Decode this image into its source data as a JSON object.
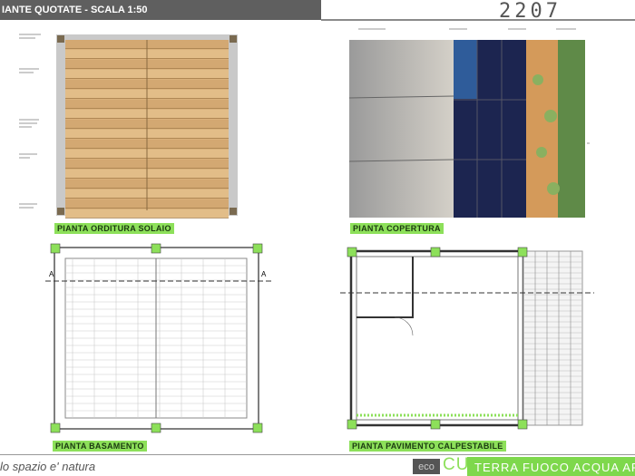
{
  "header": {
    "title": "IANTE QUOTATE - SCALA 1:50",
    "sheet_number": "2207"
  },
  "panels": {
    "p1": "PIANTA ORDITURA SOLAIO",
    "p2": "PIANTA COPERTURA",
    "p3": "PIANTA BASAMENTO",
    "p4": "PIANTA PAVIMENTO CALPESTABILE",
    "section_mark": "A"
  },
  "footer": {
    "tagline": "lo spazio e' natura",
    "logo_eco": "eco",
    "logo_cube": "CUBE",
    "slogan": "TERRA FUOCO ACQUA AR"
  },
  "colors": {
    "accent": "#8de05a",
    "header": "#5f5f5f"
  }
}
